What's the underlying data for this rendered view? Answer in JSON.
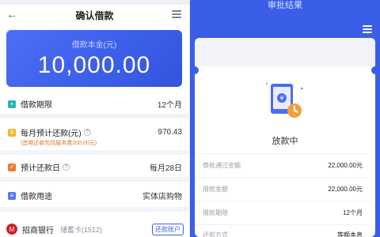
{
  "left": {
    "title": "确认借款",
    "amount_label": "借款本金(元)",
    "amount_value": "10,000.00",
    "rows": [
      {
        "label": "借款期限",
        "value": "12个月"
      },
      {
        "label": "每月预计还款(元)",
        "value": "970.43",
        "note": "(首期还款包括服务费200.00元)"
      },
      {
        "label": "预计还款日",
        "value": "每月28日"
      },
      {
        "label": "借款用途",
        "value": "实体店购物"
      }
    ],
    "bank": {
      "name": "招商银行",
      "card": "储蓄卡(1512)",
      "tag": "还款账户"
    }
  },
  "right": {
    "header_title": "审批结果",
    "status": "放款中",
    "info": [
      {
        "label": "审批通过金额",
        "value": "22,000.00元"
      },
      {
        "label": "借款金额",
        "value": "22,000.00元"
      },
      {
        "label": "借款期限",
        "value": "12个月"
      },
      {
        "label": "还款方式",
        "value": "等额本息"
      }
    ]
  },
  "colors": {
    "primary": "#3b5ee9",
    "accent_orange": "#e07b2e",
    "bank_red": "#d0202a"
  },
  "icons": [
    "back-arrow-icon",
    "menu-icon",
    "calendar-icon",
    "money-icon",
    "date-icon",
    "purpose-icon",
    "help-icon",
    "bank-logo-icon",
    "phone-money-icon",
    "clock-icon"
  ]
}
